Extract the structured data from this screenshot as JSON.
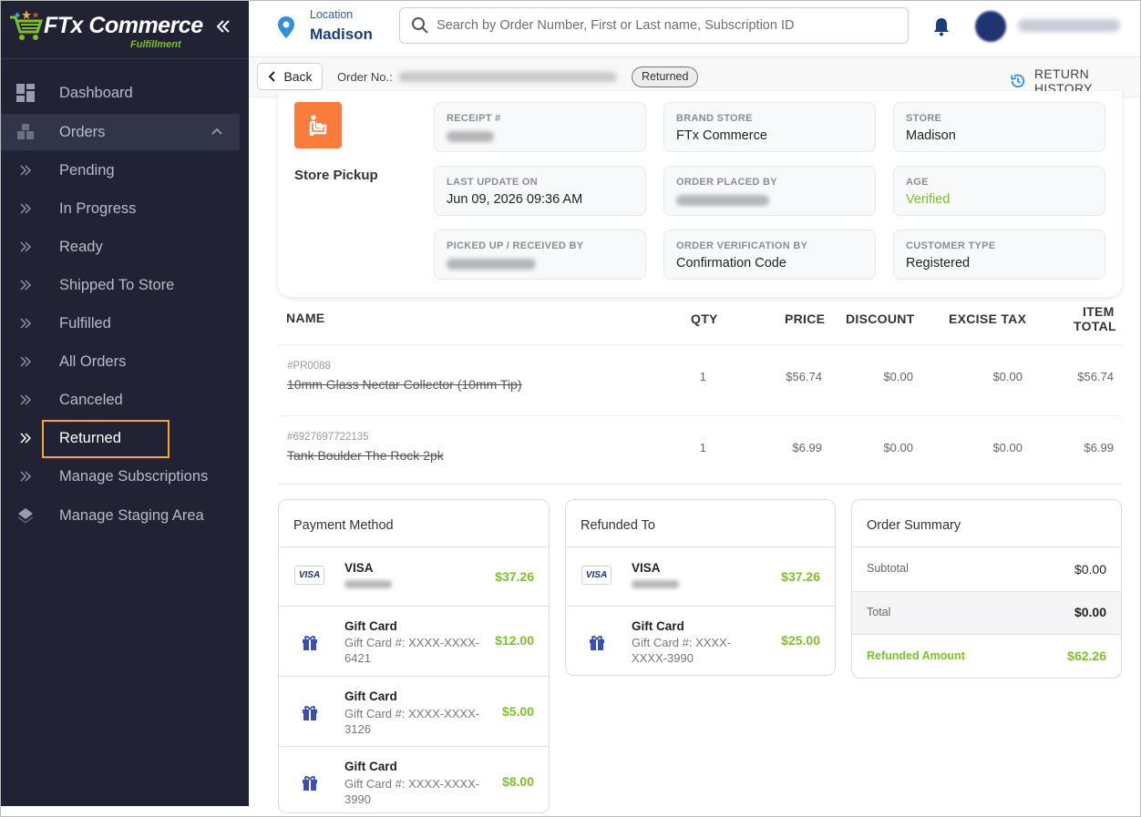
{
  "app": {
    "brand": "FTx Commerce",
    "brand_sub": "Fulfillment"
  },
  "sidebar": {
    "items": [
      {
        "label": "Dashboard",
        "icon": "dashboard-icon"
      },
      {
        "label": "Orders",
        "icon": "orders-icon"
      },
      {
        "label": "Pending",
        "icon": "double-chevron-right-icon"
      },
      {
        "label": "In Progress",
        "icon": "double-chevron-right-icon"
      },
      {
        "label": "Ready",
        "icon": "double-chevron-right-icon"
      },
      {
        "label": "Shipped To Store",
        "icon": "double-chevron-right-icon"
      },
      {
        "label": "Fulfilled",
        "icon": "double-chevron-right-icon"
      },
      {
        "label": "All Orders",
        "icon": "double-chevron-right-icon"
      },
      {
        "label": "Canceled",
        "icon": "double-chevron-right-icon"
      },
      {
        "label": "Returned",
        "icon": "double-chevron-right-icon"
      },
      {
        "label": "Manage Subscriptions",
        "icon": "double-chevron-right-icon"
      },
      {
        "label": "Manage Staging Area",
        "icon": "staging-icon"
      }
    ],
    "active": "Returned"
  },
  "topbar": {
    "location_label": "Location",
    "location_value": "Madison",
    "search_placeholder": "Search by Order Number, First or Last name, Subscription ID"
  },
  "order_header": {
    "back_label": "Back",
    "order_no_label": "Order No.:",
    "status": "Returned",
    "return_history_label": "RETURN HISTORY"
  },
  "order_info": {
    "fulfillment_type": "Store Pickup",
    "fields": {
      "receipt": {
        "label": "RECEIPT #"
      },
      "brand_store": {
        "label": "BRAND STORE",
        "value": "FTx Commerce"
      },
      "store": {
        "label": "STORE",
        "value": "Madison"
      },
      "last_update": {
        "label": "LAST UPDATE ON",
        "value": "Jun 09, 2026 09:36 AM"
      },
      "placed_by": {
        "label": "ORDER PLACED BY"
      },
      "age": {
        "label": "AGE",
        "value": "Verified"
      },
      "picked_up_by": {
        "label": "PICKED UP / RECEIVED BY"
      },
      "verification": {
        "label": "ORDER VERIFICATION BY",
        "value": "Confirmation Code"
      },
      "customer_type": {
        "label": "CUSTOMER TYPE",
        "value": "Registered"
      }
    }
  },
  "items_table": {
    "headers": {
      "name": "NAME",
      "qty": "QTY",
      "price": "PRICE",
      "discount": "DISCOUNT",
      "excise": "EXCISE TAX",
      "total_line1": "ITEM",
      "total_line2": "TOTAL"
    },
    "rows": [
      {
        "sku": "#PR0088",
        "name": "10mm Glass Nectar Collector (10mm Tip)",
        "qty": "1",
        "price": "$56.74",
        "discount": "$0.00",
        "excise": "$0.00",
        "total": "$56.74"
      },
      {
        "sku": "#6927697722135",
        "name": "Tank Boulder The Rock 2pk",
        "qty": "1",
        "price": "$6.99",
        "discount": "$0.00",
        "excise": "$0.00",
        "total": "$6.99"
      }
    ]
  },
  "payment_method": {
    "title": "Payment Method",
    "entries": [
      {
        "type": "VISA",
        "amount": "$37.26"
      },
      {
        "type": "Gift Card",
        "detail": "Gift Card #: XXXX-XXXX-6421",
        "amount": "$12.00"
      },
      {
        "type": "Gift Card",
        "detail": "Gift Card #: XXXX-XXXX-3126",
        "amount": "$5.00"
      },
      {
        "type": "Gift Card",
        "detail": "Gift Card #: XXXX-XXXX-3990",
        "amount": "$8.00"
      }
    ]
  },
  "refunded_to": {
    "title": "Refunded To",
    "entries": [
      {
        "type": "VISA",
        "amount": "$37.26"
      },
      {
        "type": "Gift Card",
        "detail": "Gift Card #: XXXX-XXXX-3990",
        "amount": "$25.00"
      }
    ]
  },
  "order_summary": {
    "title": "Order Summary",
    "subtotal_label": "Subtotal",
    "subtotal": "$0.00",
    "total_label": "Total",
    "total": "$0.00",
    "refunded_label": "Refunded Amount",
    "refunded": "$62.26"
  },
  "colors": {
    "sidebar_bg": "#212234",
    "accent_green": "#7cc12a",
    "pickup_orange": "#fa7c3c",
    "highlight_orange": "#f0a92a",
    "brand_blue": "#1b3f7a"
  }
}
